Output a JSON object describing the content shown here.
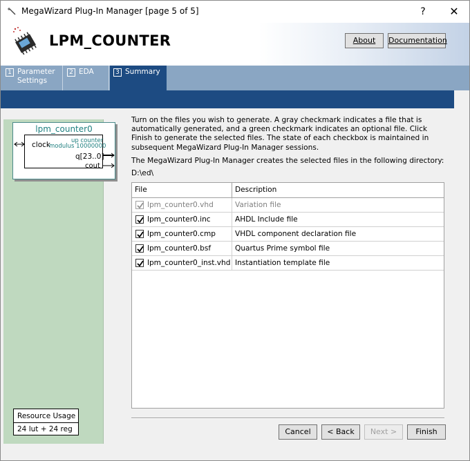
{
  "window": {
    "title": "MegaWizard Plug-In Manager [page 5 of 5]",
    "help_glyph": "?",
    "close_glyph": "✕"
  },
  "header": {
    "title": "LPM_COUNTER",
    "about_label": "About",
    "documentation_label": "Documentation"
  },
  "tabs": [
    {
      "num": "1",
      "label_line1": "Parameter",
      "label_line2": "Settings"
    },
    {
      "num": "2",
      "label_line1": "EDA",
      "label_line2": ""
    },
    {
      "num": "3",
      "label_line1": "Summary",
      "label_line2": ""
    }
  ],
  "symbol": {
    "name": "lpm_counter0",
    "clock": "clock",
    "up_counter": "up counter",
    "modulus": "modulus 10000000",
    "q": "q[23..0]",
    "cout": "cout"
  },
  "resource": {
    "title": "Resource Usage",
    "value": "24 lut + 24 reg"
  },
  "content": {
    "description": "Turn on the files you wish to generate. A gray checkmark indicates a file that is automatically generated, and a green checkmark indicates an optional file. Click Finish to generate the selected files. The state of each checkbox is maintained in subsequent MegaWizard Plug-In Manager sessions.",
    "directory_label": "The MegaWizard Plug-In Manager creates the selected files in the following directory:",
    "directory_path": "D:\\ed\\"
  },
  "table": {
    "col_file": "File",
    "col_description": "Description",
    "rows": [
      {
        "file": "lpm_counter0.vhd",
        "description": "Variation file",
        "checked": true,
        "auto": true
      },
      {
        "file": "lpm_counter0.inc",
        "description": "AHDL Include file",
        "checked": true,
        "auto": false
      },
      {
        "file": "lpm_counter0.cmp",
        "description": "VHDL component declaration file",
        "checked": true,
        "auto": false
      },
      {
        "file": "lpm_counter0.bsf",
        "description": "Quartus Prime symbol file",
        "checked": true,
        "auto": false
      },
      {
        "file": "lpm_counter0_inst.vhd",
        "description": "Instantiation template file",
        "checked": true,
        "auto": false
      }
    ]
  },
  "footer": {
    "cancel_label": "Cancel",
    "back_label": "< Back",
    "next_label": "Next >",
    "finish_label": "Finish"
  }
}
